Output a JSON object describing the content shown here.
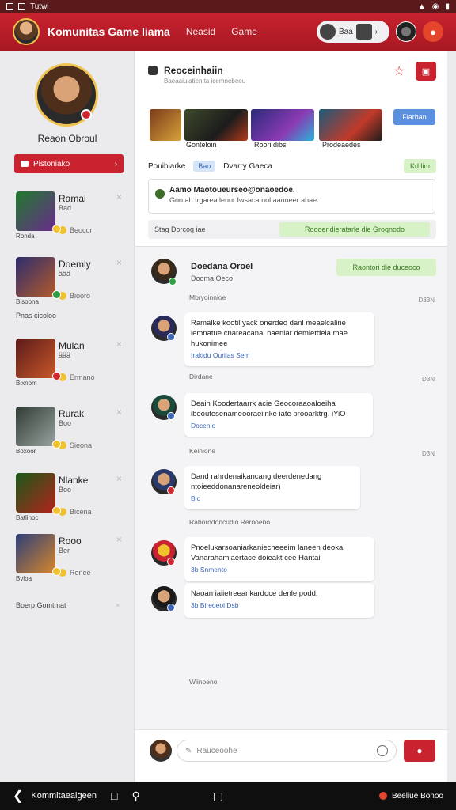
{
  "status_bar": {
    "label": "Tutwi"
  },
  "app": {
    "title": "Komunitas Game Iiama",
    "nav": [
      "Neasid",
      "Game"
    ],
    "pill_label": "Baa"
  },
  "sidebar": {
    "profile_name": "Reaon Obroul",
    "button_label": "Pistoniako",
    "games": [
      {
        "title": "Ramai",
        "sub": "Bad",
        "meta": "Beocor",
        "color_a": "#1f7a2c",
        "color_b": "#6a2a8c",
        "status": "#f2c12e"
      },
      {
        "title": "Doemly",
        "sub": "äää",
        "meta": "Biooro",
        "color_a": "#2d2d6e",
        "color_b": "#b35a2a",
        "status": "#2ea043"
      },
      {
        "title": "Mulan",
        "sub": "äää",
        "meta": "Ermano",
        "color_a": "#5b1a1a",
        "color_b": "#c9582a",
        "status": "#d0262f"
      },
      {
        "title": "Rurak",
        "sub": "Boo",
        "meta": "Sieona",
        "color_a": "#2e3b33",
        "color_b": "#9aa3a0",
        "status": "#f2c12e"
      },
      {
        "title": "Nlanke",
        "sub": "Boo",
        "meta": "Bicena",
        "color_a": "#1a5a1a",
        "color_b": "#b3221a",
        "status": "#f2c12e"
      },
      {
        "title": "Rooo",
        "sub": "Ber",
        "meta": "Ronee",
        "color_a": "#2c3f7a",
        "color_b": "#d9862a",
        "status": "#f2c12e"
      }
    ],
    "captions": [
      "Ronda",
      "Bisoona",
      "Bixnom",
      "Boxoor",
      "Batlinoc",
      "Bvloa"
    ],
    "section_1": "Pnas cicoloo",
    "section_2": "Boerp Gomtmat"
  },
  "main": {
    "conv_title": "Reoceinhaiin",
    "conv_sub": "Baeaaiulatien ta icemnebeeu",
    "blue_btn": "Fiarhan",
    "banner_caps": [
      "Gonteloin",
      "Roori dibs",
      "Prodeaedes"
    ],
    "tabs": [
      "Pouibiarke",
      "Bao",
      "Dvarry Gaeca"
    ],
    "green_chip": "Kd lim",
    "announcement_title": "Aamo Maotoueurseo@onaoedoe.",
    "announcement_sub": "Goo ab Irgareatlenor Iwsaca nol aanneer ahae.",
    "filter_label": "Stag Dorcog iae",
    "filter_green": "Roooendieratarle die Grognodo",
    "first_name": "Doedana Oroel",
    "first_sub": "Dooma Oeco",
    "first_green": "Raontori die duceoco",
    "messages": [
      {
        "header": "Mbryoinnioe",
        "time": "D33N",
        "text": "Ramalke kootil yack onerdeo danl meaelcaline lemnatue cnareacanai naeniar demletdeia mae hukonimee",
        "meta": "Irakidu Ourilas Sem"
      },
      {
        "header": "Dirdane",
        "time": "D3N",
        "text": "Deain Koodertaarrk acie Geocoraaoaloeiha ibeoutesenameooraeiinke iate prooarktrg. iYiO",
        "meta": "Docenio"
      },
      {
        "header": "Keinione",
        "time": "D3N",
        "text": "Dand rahrdenaikancang deerdenedang ntoieeddonanareneoldeiar)",
        "meta": "Bic"
      },
      {
        "header": "Raborodoncudio Rerooeno",
        "time": "",
        "text": "Pnoelukarsoaniarkaniecheeeim laneen deoka Vanarahamiaertace doieakt cee Hantai",
        "meta": "3b Snmento"
      },
      {
        "header": "",
        "time": "",
        "text": "Naoan iaiietreeankardoce denle podd.",
        "meta": "3b Bireoeoi Dsb"
      }
    ],
    "footer_label": "Wiinoeno",
    "composer_placeholder": "Rauceoohe"
  },
  "bottom_nav": {
    "label": "Kommitaeaigeen",
    "right_label": "Beeliue Bonoo"
  }
}
